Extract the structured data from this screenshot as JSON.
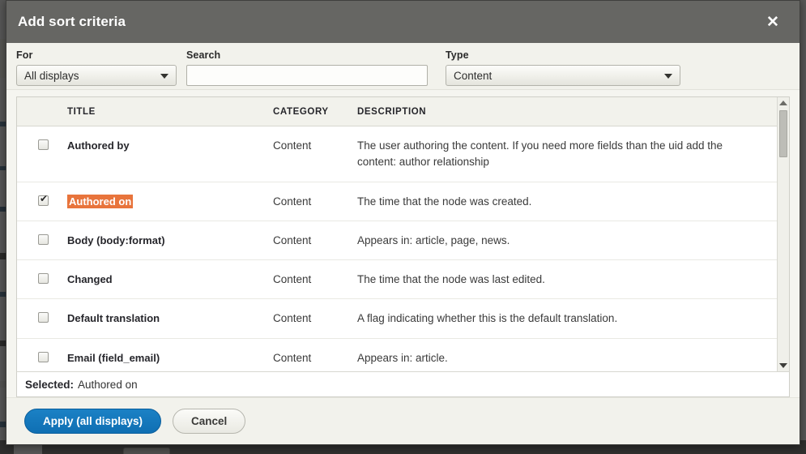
{
  "modal": {
    "title": "Add sort criteria",
    "close_icon": "close-icon"
  },
  "filters": {
    "for": {
      "label": "For",
      "value": "All displays",
      "options": [
        "All displays"
      ]
    },
    "search": {
      "label": "Search",
      "value": "",
      "placeholder": ""
    },
    "type": {
      "label": "Type",
      "value": "Content",
      "options": [
        "Content"
      ]
    }
  },
  "table": {
    "headers": {
      "check": "",
      "title": "TITLE",
      "category": "CATEGORY",
      "description": "DESCRIPTION"
    },
    "rows": [
      {
        "checked": false,
        "title": "Authored by",
        "highlight": false,
        "category": "Content",
        "description": "The user authoring the content. If you need more fields than the uid add the content: author relationship"
      },
      {
        "checked": true,
        "title": "Authored on",
        "highlight": true,
        "category": "Content",
        "description": "The time that the node was created."
      },
      {
        "checked": false,
        "title": "Body (body:format)",
        "highlight": false,
        "category": "Content",
        "description": "Appears in: article, page, news."
      },
      {
        "checked": false,
        "title": "Changed",
        "highlight": false,
        "category": "Content",
        "description": "The time that the node was last edited."
      },
      {
        "checked": false,
        "title": "Default translation",
        "highlight": false,
        "category": "Content",
        "description": "A flag indicating whether this is the default translation."
      },
      {
        "checked": false,
        "title": "Email (field_email)",
        "highlight": false,
        "category": "Content",
        "description": "Appears in: article."
      }
    ]
  },
  "selected": {
    "label": "Selected:",
    "value": "Authored on"
  },
  "actions": {
    "apply_label": "Apply (all displays)",
    "cancel_label": "Cancel"
  },
  "colors": {
    "titlebar": "#666663",
    "highlight": "#e8743c",
    "primary_button": "#0f6fb3",
    "modal_bg": "#f5f5f0"
  }
}
